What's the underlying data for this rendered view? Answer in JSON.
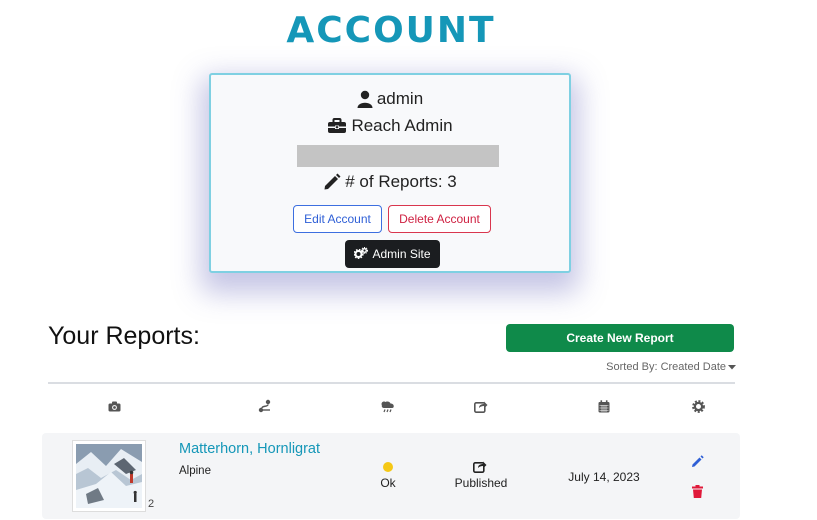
{
  "page": {
    "title": "ACCOUNT"
  },
  "account": {
    "username": "admin",
    "role": "Reach Admin",
    "report_count_label": "# of Reports: 3",
    "buttons": {
      "edit": "Edit Account",
      "delete": "Delete Account",
      "admin": "Admin Site"
    },
    "icons": {
      "user": "user-icon",
      "role": "briefcase-icon",
      "reports": "pencil-icon",
      "admin": "gears-icon"
    }
  },
  "reports": {
    "heading": "Your Reports:",
    "create_button": "Create New Report",
    "sorted_by": "Sorted By: Created Date",
    "columns": [
      "camera-icon",
      "route-icon",
      "weather-icon",
      "share-icon",
      "calendar-icon",
      "gear-icon"
    ],
    "rows": [
      {
        "title": "Matterhorn, Hornligrat",
        "type": "Alpine",
        "photo_count": "2",
        "status": "Ok",
        "status_color": "#f5c816",
        "visibility": "Published",
        "date": "July 14, 2023"
      }
    ]
  },
  "colors": {
    "title": "#1597b8",
    "create": "#0f8a4a",
    "delete": "#cf2142",
    "edit": "#2e5fd6"
  }
}
